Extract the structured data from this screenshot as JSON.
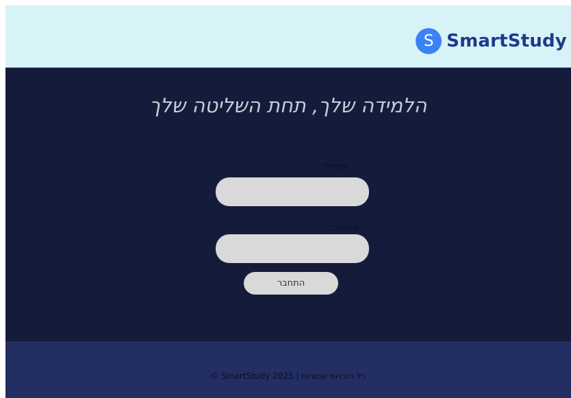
{
  "header": {
    "logo_letter": "S",
    "brand_name": "SmartStudy"
  },
  "main": {
    "headline": "הלמידה שלך, תחת השליטה שלך",
    "email_label": "אימייל:",
    "email_value": "",
    "password_label": "סיסמה:",
    "password_value": "",
    "login_button": "התחבר"
  },
  "footer": {
    "copyright": "כל הזכויות שמורות | SmartStudy 2025 ©"
  },
  "colors": {
    "header_bg": "#d8f3f8",
    "main_bg": "#151c3b",
    "footer_bg": "#232e62",
    "brand_blue": "#3b82f6",
    "brand_text": "#1e3a8a"
  }
}
